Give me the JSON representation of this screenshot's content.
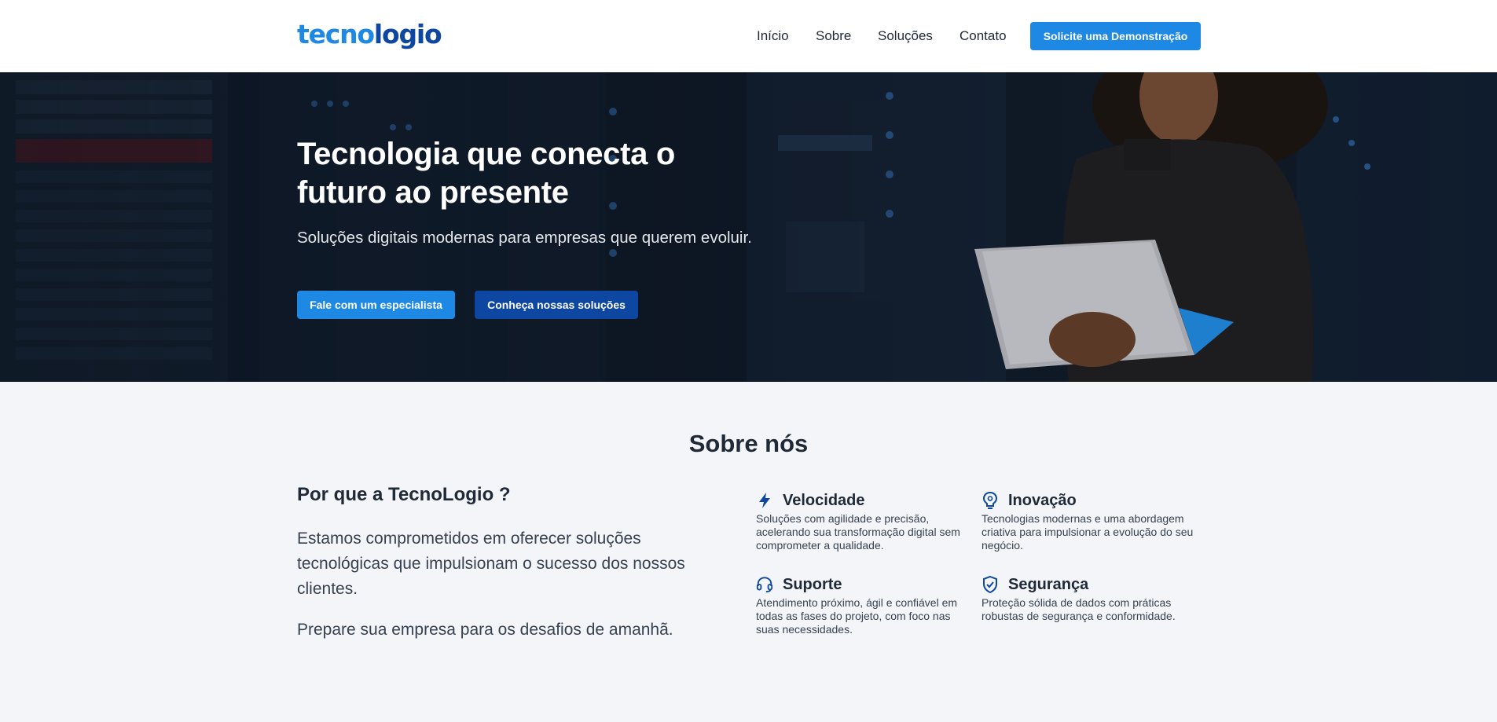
{
  "header": {
    "logo_part1": "tecno",
    "logo_part2": "logio",
    "nav": [
      "Início",
      "Sobre",
      "Soluções",
      "Contato"
    ],
    "cta": "Solicite uma Demonstração"
  },
  "hero": {
    "title": "Tecnologia que conecta o futuro ao presente",
    "subtitle": "Soluções digitais modernas para empresas que querem evoluir.",
    "primary_button": "Fale com um especialista",
    "secondary_button": "Conheça nossas soluções"
  },
  "about": {
    "heading": "Sobre nós",
    "why_title": "Por que a TecnoLogio ?",
    "paragraph1": "Estamos comprometidos em oferecer soluções tecnológicas que impulsionam o sucesso dos nossos clientes.",
    "paragraph2": "Prepare sua empresa para os desafios de amanhã.",
    "features": [
      {
        "title": "Velocidade",
        "icon": "lightning-icon",
        "desc": "Soluções com agilidade e precisão, acelerando sua transformação digital sem comprometer a qualidade."
      },
      {
        "title": "Inovação",
        "icon": "lightbulb-icon",
        "desc": "Tecnologias modernas e uma abordagem criativa para impulsionar a evolução do seu negócio."
      },
      {
        "title": "Suporte",
        "icon": "headset-icon",
        "desc": "Atendimento próximo, ágil e confiável em todas as fases do projeto, com foco nas suas necessidades."
      },
      {
        "title": "Segurança",
        "icon": "shield-check-icon",
        "desc": "Proteção sólida de dados com práticas robustas de segurança e conformidade."
      }
    ]
  },
  "colors": {
    "primary": "#1e88e5",
    "dark_blue": "#0d47a1",
    "section_bg": "#f3f5f8"
  }
}
